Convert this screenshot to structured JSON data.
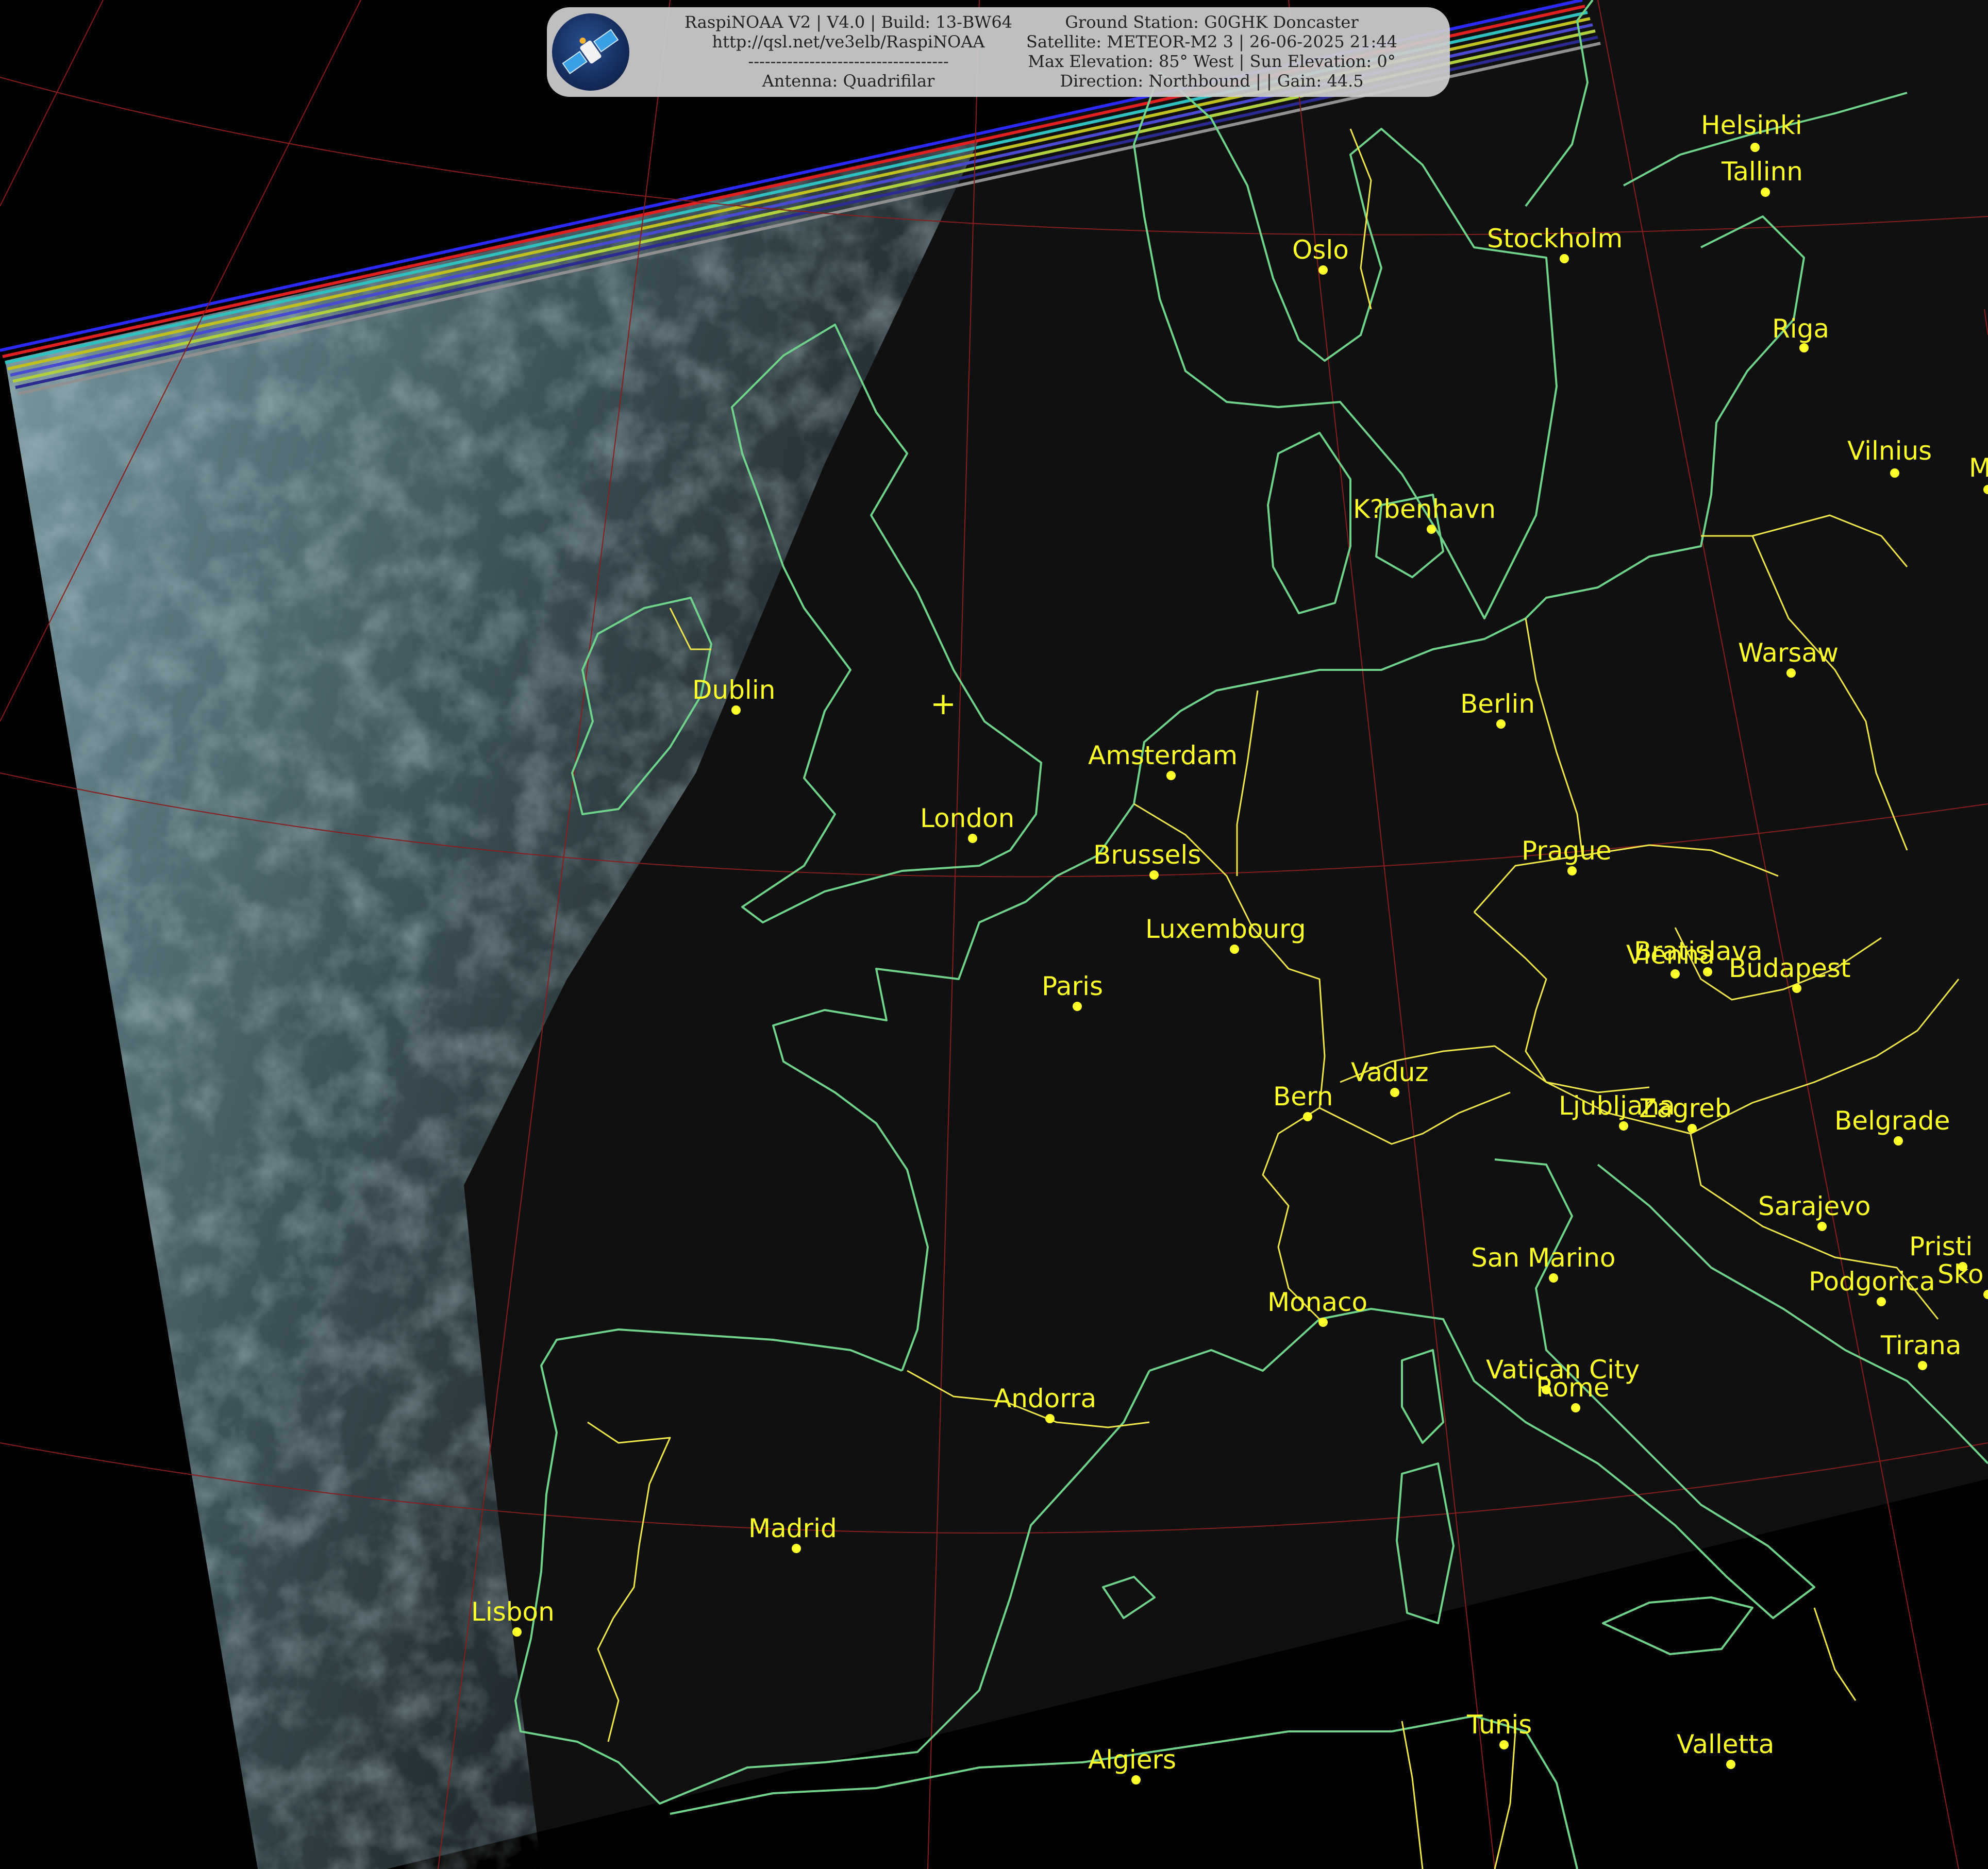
{
  "header": {
    "left_lines": [
      "RaspiNOAA V2 | V4.0 | Build: 13-BW64",
      "http://qsl.net/ve3elb/RaspiNOAA",
      "------------------------------------",
      "Antenna: Quadrifilar"
    ],
    "right_lines": [
      "Ground Station: G0GHK Doncaster",
      "Satellite: METEOR-M2 3 | 26-06-2025 21:44",
      "Max Elevation: 85° West | Sun Elevation: 0°",
      "Direction: Northbound | | Gain: 44.5"
    ],
    "logo_icon": "satellite-icon"
  },
  "cities": [
    {
      "name": "Helsinki"
    },
    {
      "name": "Tallinn"
    },
    {
      "name": "Stockholm"
    },
    {
      "name": "Oslo"
    },
    {
      "name": "Riga"
    },
    {
      "name": "Vilnius"
    },
    {
      "name": "Min"
    },
    {
      "name": "K?benhavn"
    },
    {
      "name": "Warsaw"
    },
    {
      "name": "Berlin"
    },
    {
      "name": "Dublin"
    },
    {
      "name": "Amsterdam"
    },
    {
      "name": "London"
    },
    {
      "name": "Brussels"
    },
    {
      "name": "Prague"
    },
    {
      "name": "Luxembourg"
    },
    {
      "name": "Paris"
    },
    {
      "name": "Bratislava"
    },
    {
      "name": "Vienna"
    },
    {
      "name": "Budapest"
    },
    {
      "name": "Vaduz"
    },
    {
      "name": "Bern"
    },
    {
      "name": "Ljubljana"
    },
    {
      "name": "Zagreb"
    },
    {
      "name": "Belgrade"
    },
    {
      "name": "Sarajevo"
    },
    {
      "name": "San Marino"
    },
    {
      "name": "Pristi"
    },
    {
      "name": "Monaco"
    },
    {
      "name": "Podgorica"
    },
    {
      "name": "Sko"
    },
    {
      "name": "Tirana"
    },
    {
      "name": "Andorra"
    },
    {
      "name": "Vatican City"
    },
    {
      "name": "Rome"
    },
    {
      "name": "Madrid"
    },
    {
      "name": "Lisbon"
    },
    {
      "name": "Tunis"
    },
    {
      "name": "Valletta"
    },
    {
      "name": "Algiers"
    }
  ],
  "ground_station_marker": "+",
  "colors": {
    "background": "#000000",
    "coastline": "#6fd48a",
    "border": "#f0e64a",
    "graticule": "#8a1c1c",
    "city": "#ffff2a",
    "cloud": "#5d7880",
    "land_dark": "#0f0f0f"
  }
}
